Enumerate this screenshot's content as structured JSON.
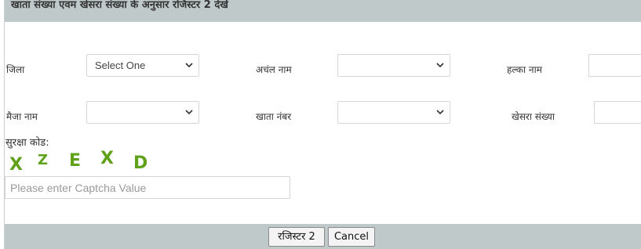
{
  "header": {
    "title": "खाता संख्या एवम खेसरा संख्या के अनुसार रजिस्टर 2 देखें"
  },
  "form": {
    "district_label": "जिला",
    "district_select_value": "Select One",
    "circle_label": "अचंल नाम",
    "circle_select_value": "",
    "halka_label": "हल्का नाम",
    "mauja_label": "मैजा नाम",
    "mauja_select_value": "",
    "khata_label": "खाता नंबर",
    "khata_select_value": "",
    "khesra_label": "खेसरा संख्या"
  },
  "captcha": {
    "label": "सुरक्षा कोड:",
    "chars": [
      "X",
      "Z",
      "E",
      "X",
      "D"
    ],
    "color": "#5fa21a",
    "input_placeholder": "Please enter Captcha Value",
    "input_value": ""
  },
  "buttons": {
    "register2_label": "रजिस्टर 2",
    "cancel_label": "Cancel"
  },
  "colors": {
    "bar": "#bfc9c9"
  }
}
